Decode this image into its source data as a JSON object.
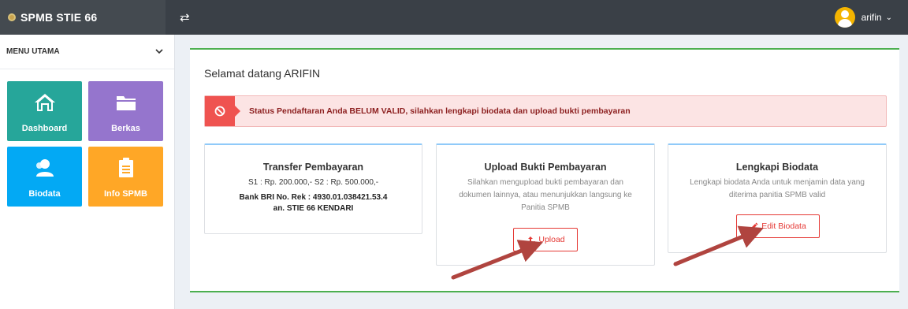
{
  "header": {
    "brand": "SPMB STIE 66",
    "toggle_icon": "⇄",
    "user_name": "arifin",
    "user_caret": "⌄"
  },
  "sidebar": {
    "menu_title": "MENU UTAMA",
    "tiles": [
      {
        "label": "Dashboard",
        "icon": "home-icon",
        "color": "#26a69a"
      },
      {
        "label": "Berkas",
        "icon": "folder-icon",
        "color": "#9575cd"
      },
      {
        "label": "Biodata",
        "icon": "user-icon",
        "color": "#03a9f4"
      },
      {
        "label": "Info SPMB",
        "icon": "clipboard-icon",
        "color": "#ffa726"
      }
    ]
  },
  "main": {
    "welcome": "Selamat datang ARIFIN",
    "alert": "Status Pendaftaran Anda BELUM VALID, silahkan lengkapi biodata dan upload bukti pembayaran",
    "cards": [
      {
        "title": "Transfer Pembayaran",
        "line1": "S1 : Rp. 200.000,- S2 : Rp. 500.000,-",
        "line2": "Bank BRI No. Rek : 4930.01.038421.53.4",
        "line3": "an. STIE 66 KENDARI"
      },
      {
        "title": "Upload Bukti Pembayaran",
        "desc": "Silahkan mengupload bukti pembayaran dan dokumen lainnya, atau menunjukkan langsung ke Panitia SPMB",
        "button": "Upload"
      },
      {
        "title": "Lengkapi Biodata",
        "desc": "Lengkapi biodata Anda untuk menjamin data yang diterima panitia SPMB valid",
        "button": "Edit Biodata"
      }
    ]
  },
  "colors": {
    "header": "#3a4047",
    "accent_green": "#4caf50",
    "alert_red": "#ef5350",
    "button_red": "#e53935",
    "arrow": "#b0443f"
  }
}
